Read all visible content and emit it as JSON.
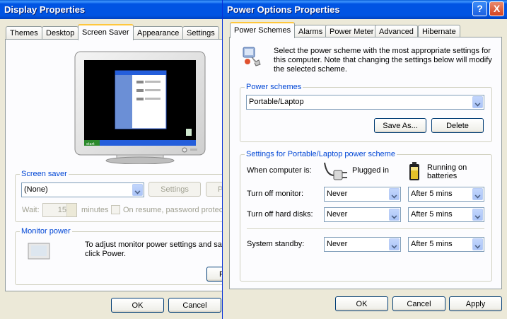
{
  "display_window": {
    "title": "Display Properties",
    "tabs": [
      "Themes",
      "Desktop",
      "Screen Saver",
      "Appearance",
      "Settings"
    ],
    "active_tab": "Screen Saver",
    "screen_saver": {
      "group_label": "Screen saver",
      "selected": "(None)",
      "settings_button": "Settings",
      "preview_button_partial": "P",
      "wait_label": "Wait:",
      "wait_value": "15",
      "minutes_label": "minutes",
      "password_label": "On resume, password protect"
    },
    "monitor_power": {
      "group_label": "Monitor power",
      "description": "To adjust monitor power settings and save energy, click Power.",
      "description_line1": "To adjust monitor power settings and save",
      "description_line2": "click Power.",
      "power_button_partial": "P"
    },
    "ok_button": "OK",
    "cancel_button": "Cancel"
  },
  "power_window": {
    "title": "Power Options Properties",
    "tabs": [
      "Power Schemes",
      "Alarms",
      "Power Meter",
      "Advanced",
      "Hibernate"
    ],
    "active_tab": "Power Schemes",
    "intro_line1": "Select the power scheme with the most appropriate settings for",
    "intro_line2": "this computer. Note that changing the settings below will modify",
    "intro_line3": "the selected scheme.",
    "schemes_group_label": "Power schemes",
    "selected_scheme": "Portable/Laptop",
    "save_as_button": "Save As...",
    "delete_button": "Delete",
    "settings_group_label": "Settings for Portable/Laptop power scheme",
    "when_computer_is": "When computer is:",
    "plugged_in": "Plugged in",
    "running_on_line1": "Running on",
    "running_on_line2": "batteries",
    "rows": [
      {
        "label": "Turn off monitor:",
        "plugged": "Never",
        "battery": "After 5 mins"
      },
      {
        "label": "Turn off hard disks:",
        "plugged": "Never",
        "battery": "After 5 mins"
      },
      {
        "label": "System standby:",
        "plugged": "Never",
        "battery": "After 5 mins"
      }
    ],
    "ok_button": "OK",
    "cancel_button": "Cancel",
    "apply_button": "Apply",
    "help_button": "?",
    "close_button": "X"
  },
  "monitor_preview": {
    "start_label": "start"
  },
  "colors": {
    "titlebar": "#0054e3",
    "accent_legend": "#0046d5",
    "close_red": "#e0512e",
    "desktop_green": "#2c8a2c",
    "taskbar_blue": "#245edb"
  }
}
